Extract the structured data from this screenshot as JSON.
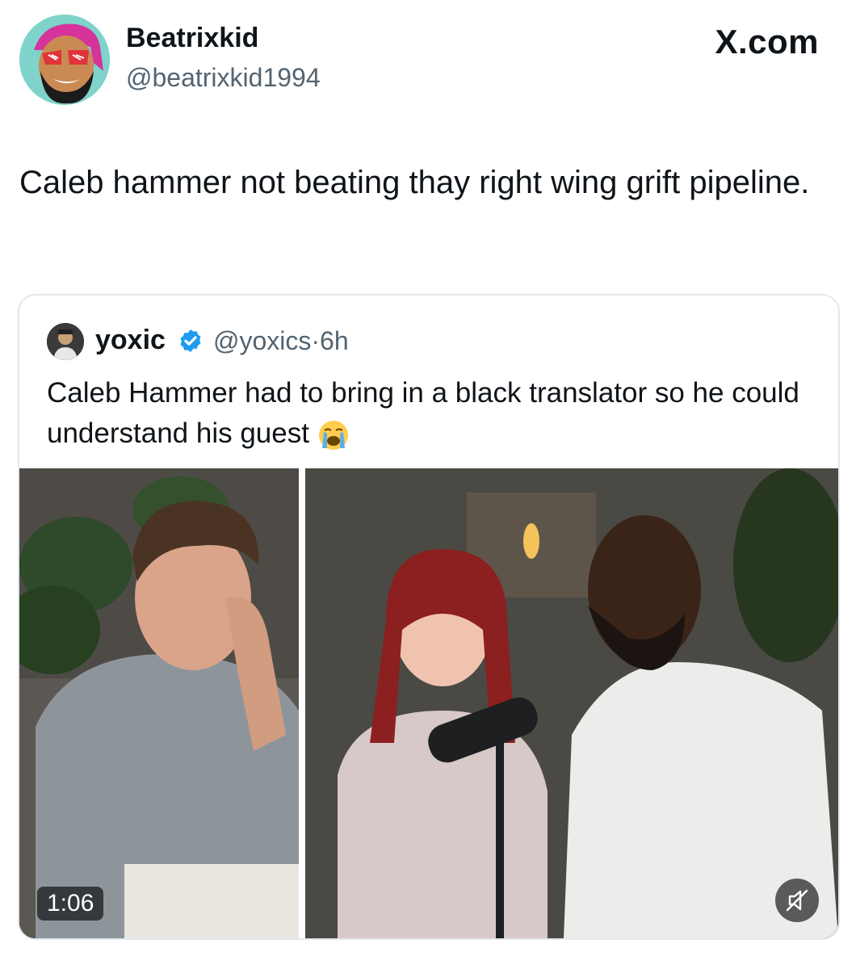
{
  "author": {
    "display_name": "Beatrixkid",
    "handle": "@beatrixkid1994",
    "avatar_icon": "cartoon-avatar-icon"
  },
  "brand": {
    "label": "X.com"
  },
  "tweet": {
    "text": "Caleb hammer not beating thay right wing grift pipeline."
  },
  "quoted_tweet": {
    "name": "yoxic",
    "verified_icon": "verified-badge-icon",
    "handle": "@yoxics",
    "separator": "·",
    "time": "6h",
    "text": "Caleb Hammer had to bring in a black translator so he could understand his guest",
    "emoji_icon": "loudly-crying-face-icon",
    "video": {
      "timestamp": "1:06",
      "mute_icon": "speaker-muted-icon"
    }
  },
  "colors": {
    "text": "#0f1419",
    "secondary": "#536471",
    "verified": "#1d9bf0",
    "border": "#e5e8eb"
  }
}
